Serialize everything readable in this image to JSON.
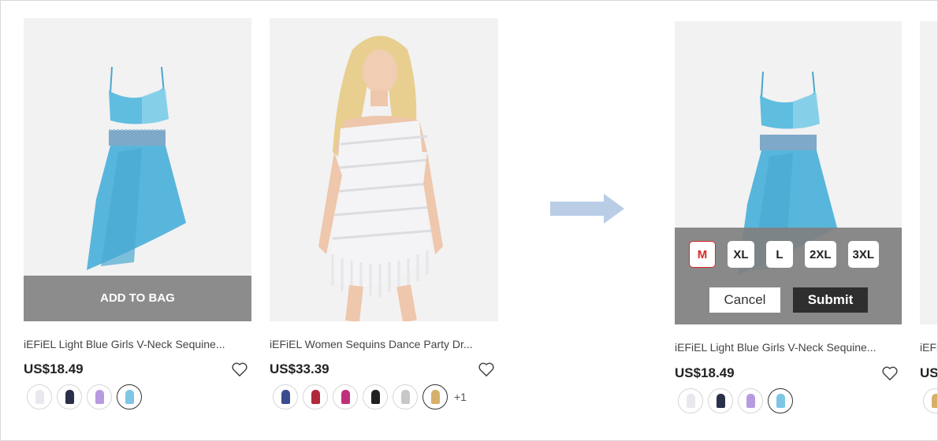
{
  "products": [
    {
      "title": "iEFiEL Light Blue Girls V-Neck Sequine...",
      "price": "US$18.49",
      "add_to_bag_label": "ADD TO BAG",
      "swatch_colors": [
        "#e8e8ee",
        "#2a2f4a",
        "#b79be0",
        "#7fc6e6"
      ],
      "selected_swatch": 3
    },
    {
      "title": "iEFiEL Women Sequins Dance Party Dr...",
      "price": "US$33.39",
      "swatch_colors": [
        "#3a4c8f",
        "#b0283a",
        "#c0307a",
        "#222222",
        "#c8c8c8",
        "#d6b06a"
      ],
      "selected_swatch": 5,
      "more_colors": "+1"
    }
  ],
  "detail_product": {
    "title": "iEFiEL Light Blue Girls V-Neck Sequine...",
    "price": "US$18.49",
    "swatch_colors": [
      "#e8e8ee",
      "#2a2f4a",
      "#b79be0",
      "#7fc6e6"
    ],
    "selected_swatch": 3,
    "sizes": [
      "M",
      "XL",
      "L",
      "2XL",
      "3XL"
    ],
    "selected_size": "M",
    "cancel_label": "Cancel",
    "submit_label": "Submit"
  },
  "partial_product": {
    "title": "iEFi",
    "price": "US"
  },
  "colors": {
    "dress_blue": "#5fbde0",
    "overlay_gray": "#8c8c8c",
    "arrow": "#b9cde6",
    "size_active": "#d52b2b"
  }
}
